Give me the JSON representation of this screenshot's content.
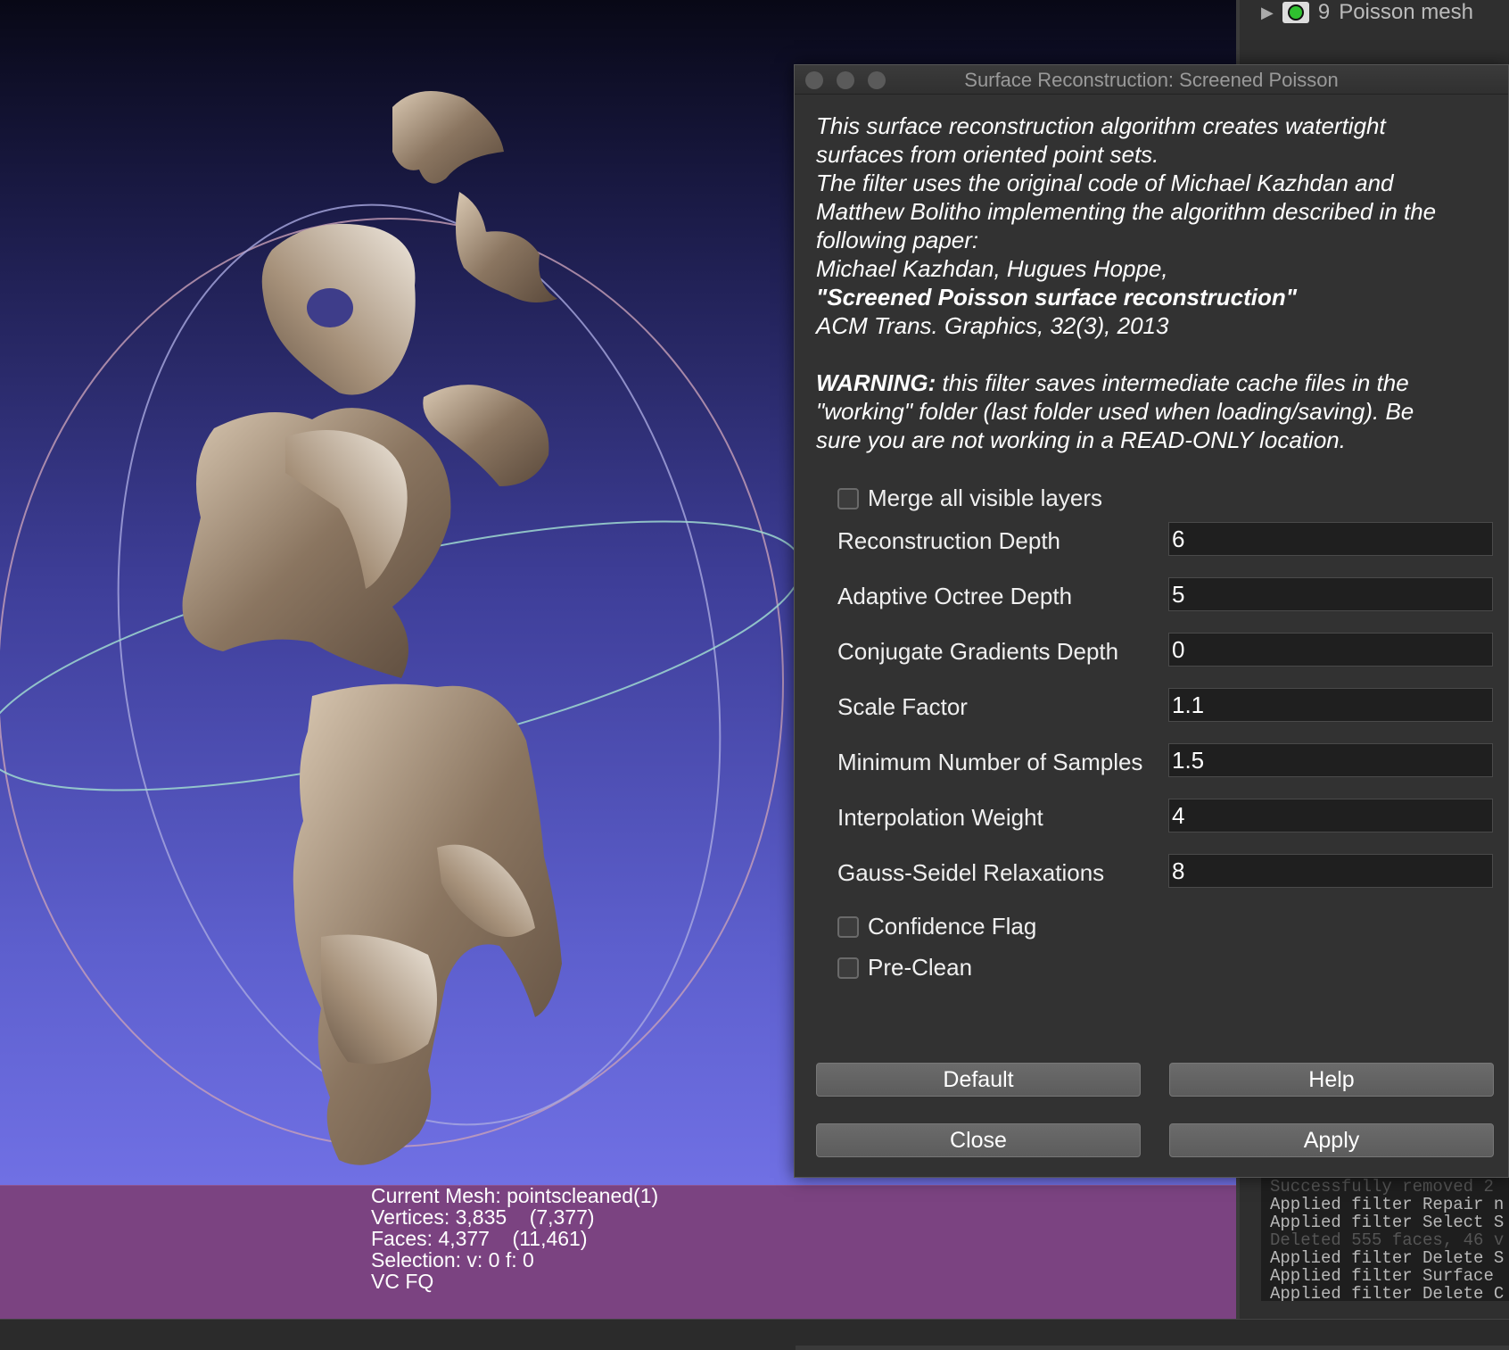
{
  "layers": {
    "index": "9",
    "name": "Poisson mesh"
  },
  "info": {
    "current_mesh": "Current Mesh: pointscleaned(1)",
    "vertices": "Vertices: 3,835    (7,377)",
    "faces": "Faces: 4,377    (11,461)",
    "selection": "Selection: v: 0 f: 0",
    "flags": "VC FQ"
  },
  "log": [
    "Successfully removed 2",
    "Applied filter Repair n",
    "Applied filter Select S",
    "Deleted 555 faces, 46 v",
    "Applied filter Delete S",
    "Applied filter Surface",
    "Applied filter Delete C"
  ],
  "dialog": {
    "title": "Surface Reconstruction: Screened Poisson",
    "description": [
      "This surface reconstruction algorithm creates watertight",
      "surfaces from oriented point sets.",
      "The filter uses the original code of Michael Kazhdan and",
      "Matthew Bolitho implementing the algorithm described in the",
      "following paper:",
      "Michael Kazhdan, Hugues Hoppe,",
      "\"Screened Poisson surface reconstruction\"",
      "ACM Trans. Graphics, 32(3), 2013"
    ],
    "warning_label": "WARNING:",
    "warning_lines": [
      " this filter saves intermediate cache files in the",
      "\"working\" folder (last folder used when loading/saving). Be",
      "sure you are not working in a READ-ONLY location."
    ],
    "merge_label": "Merge all visible layers",
    "params": [
      {
        "label": "Reconstruction Depth",
        "value": "6"
      },
      {
        "label": "Adaptive Octree Depth",
        "value": "5"
      },
      {
        "label": "Conjugate Gradients Depth",
        "value": "0"
      },
      {
        "label": "Scale Factor",
        "value": "1.1"
      },
      {
        "label": "Minimum Number of Samples",
        "value": "1.5"
      },
      {
        "label": "Interpolation Weight",
        "value": "4"
      },
      {
        "label": "Gauss-Seidel Relaxations",
        "value": "8"
      }
    ],
    "confidence_label": "Confidence Flag",
    "preclean_label": "Pre-Clean",
    "buttons": {
      "default": "Default",
      "help": "Help",
      "close": "Close",
      "apply": "Apply"
    }
  }
}
